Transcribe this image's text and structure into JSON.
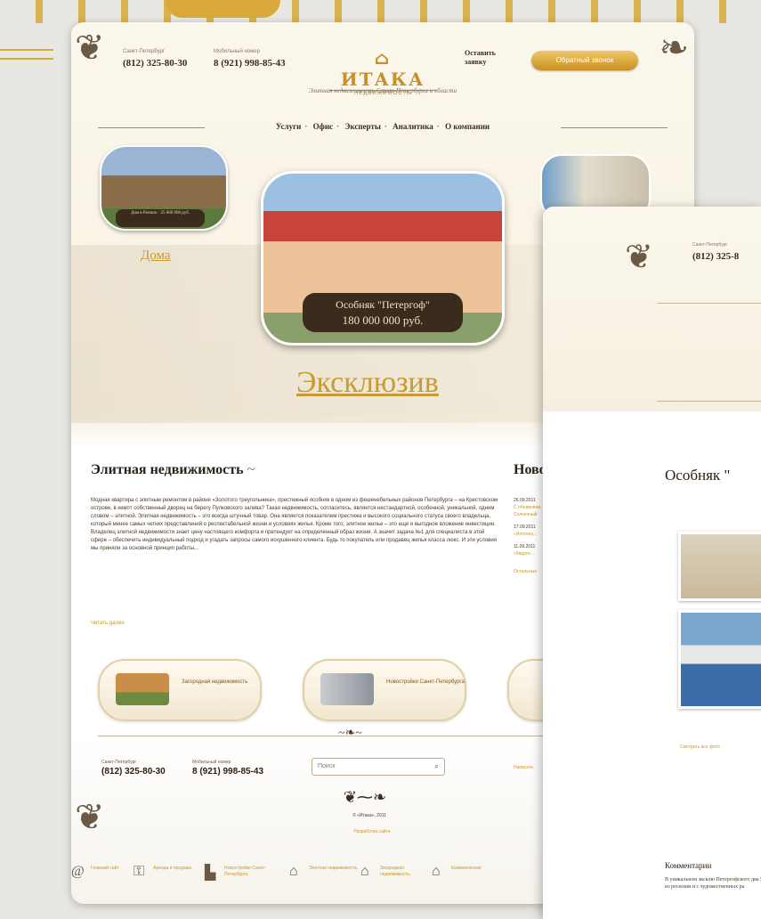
{
  "header": {
    "city_label": "Санкт-Петербург",
    "city_phone": "(812) 325-80-30",
    "mobile_label": "Мобильный номер",
    "mobile_phone": "8 (921) 998-85-43",
    "logo_word": "ИТАКА",
    "logo_sub": "НЕДВИЖИМОСТЬ",
    "tagline": "Элитная недвижимость Санкт-Петербурга и области",
    "request_label": "Оставить заявку",
    "callback_button": "Обратный звонок"
  },
  "nav": [
    "Услуги",
    "Офис",
    "Эксперты",
    "Аналитика",
    "О компании"
  ],
  "hero": {
    "left_caption": "Дом в Репино · 25 000 000 руб.",
    "left_link": "Дома",
    "main_title": "Особняк \"Петергоф\"",
    "main_price": "180 000 000 руб.",
    "exclusive_link": "Эксклюзив"
  },
  "elite": {
    "heading": "Элитная недвижимость",
    "text": "Модная квартира с элитным ремонтом в районе «Золотого треугольника», престижный особняк в одном из фешенебельных районов Петербурга – на Крестовском острове, в кемпт собственный дворец на берегу Пулковского залива? Такая недвижимость, согласитесь, является нестандартной, особенной, уникальной, одним словом – элитной. Элитная недвижимость – это всегда штучный товар. Она является показателем престижа и высокого социального статуса своего владельца, который менее самых четких представлений о респектабельной жизни и условиях жилья. Кроме того, элитное жилье – это еще и выгодное вложение инвестиции. Владелец элитной недвижимости знает цену настоящего комфорта и претендует на определенный образ жизни. А значит задача №1 для специалиста в этой сфере – обеспечить индивидуальный подход и угадать запросы самого искушенного клиента. Будь то покупатель или продавец жилья класса люкс. И эти условия мы приняли за основной принцип работы...",
    "more": "Читать далее"
  },
  "news": {
    "heading": "Новости",
    "items": [
      {
        "date": "26.09.2011",
        "text": "С объявлени... Солнечный"
      },
      {
        "date": "17.09.2011",
        "text": "«Ипотека..."
      },
      {
        "date": "11.09.2011",
        "text": "«Кварти..."
      }
    ],
    "all": "Остальные"
  },
  "cards": [
    {
      "label": "Загородная недвижимость"
    },
    {
      "label": "Новостройки Санкт-Петербурга"
    }
  ],
  "footer": {
    "city_label": "Санкт-Петербург",
    "city_phone": "(812) 325-80-30",
    "mobile_label": "Мобильный номер",
    "mobile_phone": "8 (921) 998-85-43",
    "search_placeholder": "Поиск",
    "right_link": "Написать",
    "copyright": "© «Итака», 2011",
    "developer": "Разработка сайта"
  },
  "bottombar": [
    {
      "icon": "home-icon",
      "label": "Главный сайт"
    },
    {
      "icon": "key-icon",
      "label": "Аренда и продажа"
    },
    {
      "icon": "buildings-icon",
      "label": "Новостройки Санкт-Петербурга"
    },
    {
      "icon": "house-icon",
      "label": "Элитная недвижимость"
    },
    {
      "icon": "cottage-icon",
      "label": "Загородная недвижимость"
    },
    {
      "icon": "commercial-icon",
      "label": "Коммерческая"
    }
  ],
  "page2": {
    "city_label": "Санкт-Петербург",
    "phone": "(812) 325-8",
    "title": "Особняк \"",
    "photos_link": "Смотреть все фото",
    "comments_heading": "Комментарии",
    "comments_text": "В уникальном эксклю Петергофского два 530 из роскоши и с художественных ра"
  }
}
